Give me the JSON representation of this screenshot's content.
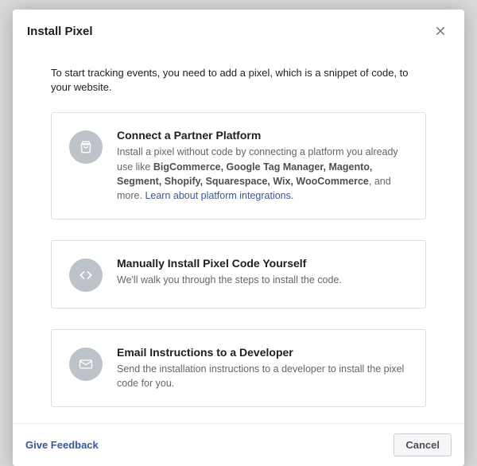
{
  "modal": {
    "title": "Install Pixel",
    "intro": "To start tracking events, you need to add a pixel, which is a snippet of code, to your website."
  },
  "options": {
    "partner": {
      "title": "Connect a Partner Platform",
      "desc_prefix": "Install a pixel without code by connecting a platform you already use like ",
      "partners_csv": "BigCommerce, Google Tag Manager, Magento, Segment, Shopify, Squarespace, Wix, WooCommerce",
      "desc_mid": ", and more. ",
      "link_text": "Learn about platform integrations."
    },
    "manual": {
      "title": "Manually Install Pixel Code Yourself",
      "desc": "We'll walk you through the steps to install the code."
    },
    "email": {
      "title": "Email Instructions to a Developer",
      "desc": "Send the installation instructions to a developer to install the pixel code for you."
    }
  },
  "footer": {
    "feedback": "Give Feedback",
    "cancel": "Cancel"
  }
}
